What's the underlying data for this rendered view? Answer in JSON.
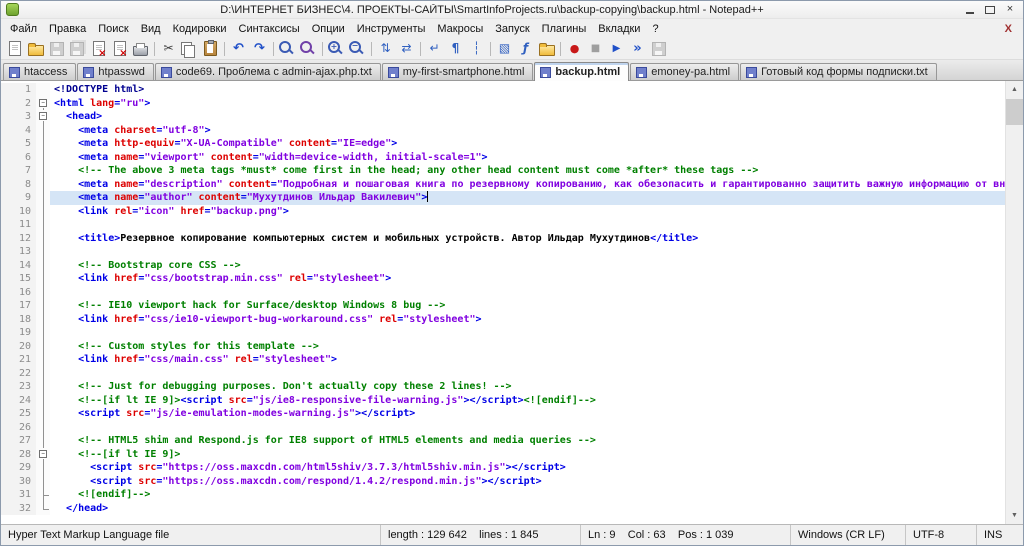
{
  "window": {
    "title": "D:\\ИНТЕРНЕТ БИЗНЕС\\4. ПРОЕКТЫ-САЙТЫ\\SmartInfoProjects.ru\\backup-copying\\backup.html - Notepad++"
  },
  "menubar": {
    "items": [
      {
        "label": "Файл",
        "name": "file"
      },
      {
        "label": "Правка",
        "name": "edit"
      },
      {
        "label": "Поиск",
        "name": "search"
      },
      {
        "label": "Вид",
        "name": "view"
      },
      {
        "label": "Кодировки",
        "name": "encoding"
      },
      {
        "label": "Синтаксисы",
        "name": "language"
      },
      {
        "label": "Опции",
        "name": "settings"
      },
      {
        "label": "Инструменты",
        "name": "tools"
      },
      {
        "label": "Макросы",
        "name": "macro"
      },
      {
        "label": "Запуск",
        "name": "run"
      },
      {
        "label": "Плагины",
        "name": "plugins"
      },
      {
        "label": "Вкладки",
        "name": "window-tabs"
      },
      {
        "label": "?",
        "name": "help"
      }
    ],
    "close_label": "X"
  },
  "toolbar": {
    "icons": [
      {
        "name": "new-file",
        "enabled": true
      },
      {
        "name": "open-folder",
        "enabled": true
      },
      {
        "name": "save",
        "enabled": false
      },
      {
        "name": "save-all",
        "enabled": false
      },
      {
        "name": "close-file",
        "enabled": true
      },
      {
        "name": "close-all",
        "enabled": true
      },
      {
        "name": "print",
        "enabled": true
      },
      {
        "name": "separator"
      },
      {
        "name": "cut",
        "enabled": true
      },
      {
        "name": "copy",
        "enabled": true
      },
      {
        "name": "paste",
        "enabled": true
      },
      {
        "name": "separator"
      },
      {
        "name": "undo",
        "enabled": true
      },
      {
        "name": "redo",
        "enabled": true
      },
      {
        "name": "separator"
      },
      {
        "name": "find",
        "enabled": true
      },
      {
        "name": "replace",
        "enabled": true
      },
      {
        "name": "separator"
      },
      {
        "name": "zoom-in",
        "enabled": true
      },
      {
        "name": "zoom-out",
        "enabled": true
      },
      {
        "name": "separator"
      },
      {
        "name": "sync-vertical",
        "enabled": true
      },
      {
        "name": "sync-horizontal",
        "enabled": true
      },
      {
        "name": "separator"
      },
      {
        "name": "word-wrap",
        "enabled": true
      },
      {
        "name": "show-all-chars",
        "enabled": true
      },
      {
        "name": "indent-guide",
        "enabled": true
      },
      {
        "name": "separator"
      },
      {
        "name": "doc-map",
        "enabled": true
      },
      {
        "name": "function-list",
        "enabled": true
      },
      {
        "name": "folder-workspace",
        "enabled": true
      },
      {
        "name": "separator"
      },
      {
        "name": "record-macro",
        "enabled": true
      },
      {
        "name": "stop-macro",
        "enabled": false
      },
      {
        "name": "play-macro",
        "enabled": true
      },
      {
        "name": "run-macro-multi",
        "enabled": true
      },
      {
        "name": "save-macro",
        "enabled": false
      }
    ]
  },
  "tabs": [
    {
      "label": "htaccess",
      "name": "htaccess",
      "active": false
    },
    {
      "label": "htpasswd",
      "name": "htpasswd",
      "active": false
    },
    {
      "label": "code69. Проблема с admin-ajax.php.txt",
      "name": "code69-admin-ajax",
      "active": false
    },
    {
      "label": "my-first-smartphone.html",
      "name": "my-first-smartphone",
      "active": false
    },
    {
      "label": "backup.html",
      "name": "backup",
      "active": true
    },
    {
      "label": "emoney-pa.html",
      "name": "emoney-pa",
      "active": false
    },
    {
      "label": "Готовый код формы подписки.txt",
      "name": "subscribe-form-code",
      "active": false
    }
  ],
  "editor": {
    "caret": {
      "line": 9,
      "col": 63
    },
    "lines": [
      {
        "n": 1,
        "i": 0,
        "f": "",
        "segs": [
          [
            "d",
            "<!DOCTYPE html>"
          ]
        ]
      },
      {
        "n": 2,
        "i": 0,
        "f": "box",
        "segs": [
          [
            "t",
            "<html "
          ],
          [
            "a",
            "lang"
          ],
          [
            "t",
            "="
          ],
          [
            "v",
            "\"ru\""
          ],
          [
            "t",
            ">"
          ]
        ]
      },
      {
        "n": 3,
        "i": 2,
        "f": "box",
        "segs": [
          [
            "t",
            "<head>"
          ]
        ]
      },
      {
        "n": 4,
        "i": 4,
        "f": "line",
        "segs": [
          [
            "t",
            "<meta "
          ],
          [
            "a",
            "charset"
          ],
          [
            "t",
            "="
          ],
          [
            "v",
            "\"utf-8\""
          ],
          [
            "t",
            ">"
          ]
        ]
      },
      {
        "n": 5,
        "i": 4,
        "f": "line",
        "segs": [
          [
            "t",
            "<meta "
          ],
          [
            "a",
            "http-equiv"
          ],
          [
            "t",
            "="
          ],
          [
            "v",
            "\"X-UA-Compatible\""
          ],
          [
            "a",
            " content"
          ],
          [
            "t",
            "="
          ],
          [
            "v",
            "\"IE=edge\""
          ],
          [
            "t",
            ">"
          ]
        ]
      },
      {
        "n": 6,
        "i": 4,
        "f": "line",
        "segs": [
          [
            "t",
            "<meta "
          ],
          [
            "a",
            "name"
          ],
          [
            "t",
            "="
          ],
          [
            "v",
            "\"viewport\""
          ],
          [
            "a",
            " content"
          ],
          [
            "t",
            "="
          ],
          [
            "v",
            "\"width=device-width, initial-scale=1\""
          ],
          [
            "t",
            ">"
          ]
        ]
      },
      {
        "n": 7,
        "i": 4,
        "f": "line",
        "segs": [
          [
            "c",
            "<!-- The above 3 meta tags *must* come first in the head; any other head content must come *after* these tags -->"
          ]
        ]
      },
      {
        "n": 8,
        "i": 4,
        "f": "line",
        "segs": [
          [
            "t",
            "<meta "
          ],
          [
            "a",
            "name"
          ],
          [
            "t",
            "="
          ],
          [
            "v",
            "\"description\""
          ],
          [
            "a",
            " content"
          ],
          [
            "t",
            "="
          ],
          [
            "v",
            "\"Подробная и пошаговая книга по резервному копированию, как обезопасить и гарантированно защитить важную информацию от внез"
          ]
        ]
      },
      {
        "n": 9,
        "i": 4,
        "f": "line",
        "cur": true,
        "caret": true,
        "segs": [
          [
            "t",
            "<meta "
          ],
          [
            "a",
            "name"
          ],
          [
            "t",
            "="
          ],
          [
            "v",
            "\"author\""
          ],
          [
            "a",
            " content"
          ],
          [
            "t",
            "="
          ],
          [
            "v",
            "\"Мухутдинов Ильдар Вакилевич\""
          ],
          [
            "t",
            ">"
          ]
        ]
      },
      {
        "n": 10,
        "i": 4,
        "f": "line",
        "segs": [
          [
            "t",
            "<link "
          ],
          [
            "a",
            "rel"
          ],
          [
            "t",
            "="
          ],
          [
            "v",
            "\"icon\""
          ],
          [
            "a",
            " href"
          ],
          [
            "t",
            "="
          ],
          [
            "v",
            "\"backup.png\""
          ],
          [
            "t",
            ">"
          ]
        ]
      },
      {
        "n": 11,
        "i": 0,
        "f": "line",
        "segs": []
      },
      {
        "n": 12,
        "i": 4,
        "f": "line",
        "segs": [
          [
            "t",
            "<title>"
          ],
          [
            "x",
            "Резервное копирование компьютерных систем и мобильных устройств. Автор Ильдар Мухутдинов"
          ],
          [
            "t",
            "</title>"
          ]
        ]
      },
      {
        "n": 13,
        "i": 0,
        "f": "line",
        "segs": []
      },
      {
        "n": 14,
        "i": 4,
        "f": "line",
        "segs": [
          [
            "c",
            "<!-- Bootstrap core CSS -->"
          ]
        ]
      },
      {
        "n": 15,
        "i": 4,
        "f": "line",
        "segs": [
          [
            "t",
            "<link "
          ],
          [
            "a",
            "href"
          ],
          [
            "t",
            "="
          ],
          [
            "v",
            "\"css/bootstrap.min.css\""
          ],
          [
            "a",
            " rel"
          ],
          [
            "t",
            "="
          ],
          [
            "v",
            "\"stylesheet\""
          ],
          [
            "t",
            ">"
          ]
        ]
      },
      {
        "n": 16,
        "i": 0,
        "f": "line",
        "segs": []
      },
      {
        "n": 17,
        "i": 4,
        "f": "line",
        "segs": [
          [
            "c",
            "<!-- IE10 viewport hack for Surface/desktop Windows 8 bug -->"
          ]
        ]
      },
      {
        "n": 18,
        "i": 4,
        "f": "line",
        "segs": [
          [
            "t",
            "<link "
          ],
          [
            "a",
            "href"
          ],
          [
            "t",
            "="
          ],
          [
            "v",
            "\"css/ie10-viewport-bug-workaround.css\""
          ],
          [
            "a",
            " rel"
          ],
          [
            "t",
            "="
          ],
          [
            "v",
            "\"stylesheet\""
          ],
          [
            "t",
            ">"
          ]
        ]
      },
      {
        "n": 19,
        "i": 0,
        "f": "line",
        "segs": []
      },
      {
        "n": 20,
        "i": 4,
        "f": "line",
        "segs": [
          [
            "c",
            "<!-- Custom styles for this template -->"
          ]
        ]
      },
      {
        "n": 21,
        "i": 4,
        "f": "line",
        "segs": [
          [
            "t",
            "<link "
          ],
          [
            "a",
            "href"
          ],
          [
            "t",
            "="
          ],
          [
            "v",
            "\"css/main.css\""
          ],
          [
            "a",
            " rel"
          ],
          [
            "t",
            "="
          ],
          [
            "v",
            "\"stylesheet\""
          ],
          [
            "t",
            ">"
          ]
        ]
      },
      {
        "n": 22,
        "i": 0,
        "f": "line",
        "segs": []
      },
      {
        "n": 23,
        "i": 4,
        "f": "line",
        "segs": [
          [
            "c",
            "<!-- Just for debugging purposes. Don't actually copy these 2 lines! -->"
          ]
        ]
      },
      {
        "n": 24,
        "i": 4,
        "f": "line",
        "segs": [
          [
            "c",
            "<!--[if lt IE 9]>"
          ],
          [
            "t",
            "<script "
          ],
          [
            "a",
            "src"
          ],
          [
            "t",
            "="
          ],
          [
            "v",
            "\"js/ie8-responsive-file-warning.js\""
          ],
          [
            "t",
            "></script>"
          ],
          [
            "c",
            "<![endif]-->"
          ]
        ]
      },
      {
        "n": 25,
        "i": 4,
        "f": "line",
        "segs": [
          [
            "t",
            "<script "
          ],
          [
            "a",
            "src"
          ],
          [
            "t",
            "="
          ],
          [
            "v",
            "\"js/ie-emulation-modes-warning.js\""
          ],
          [
            "t",
            "></script>"
          ]
        ]
      },
      {
        "n": 26,
        "i": 0,
        "f": "line",
        "segs": []
      },
      {
        "n": 27,
        "i": 4,
        "f": "line",
        "segs": [
          [
            "c",
            "<!-- HTML5 shim and Respond.js for IE8 support of HTML5 elements and media queries -->"
          ]
        ]
      },
      {
        "n": 28,
        "i": 4,
        "f": "box",
        "segs": [
          [
            "c",
            "<!--[if lt IE 9]>"
          ]
        ]
      },
      {
        "n": 29,
        "i": 6,
        "f": "line",
        "segs": [
          [
            "t",
            "<script "
          ],
          [
            "a",
            "src"
          ],
          [
            "t",
            "="
          ],
          [
            "v",
            "\"https://oss.maxcdn.com/html5shiv/3.7.3/html5shiv.min.js\""
          ],
          [
            "t",
            "></script>"
          ]
        ]
      },
      {
        "n": 30,
        "i": 6,
        "f": "line",
        "segs": [
          [
            "t",
            "<script "
          ],
          [
            "a",
            "src"
          ],
          [
            "t",
            "="
          ],
          [
            "v",
            "\"https://oss.maxcdn.com/respond/1.4.2/respond.min.js\""
          ],
          [
            "t",
            "></script>"
          ]
        ]
      },
      {
        "n": 31,
        "i": 4,
        "f": "tee",
        "segs": [
          [
            "c",
            "<![endif]-->"
          ]
        ]
      },
      {
        "n": 32,
        "i": 2,
        "f": "end",
        "segs": [
          [
            "t",
            "</head>"
          ]
        ]
      }
    ]
  },
  "statusbar": {
    "doc_type": "Hyper Text Markup Language file",
    "doc_stats": "length : 129 642    lines : 1 845",
    "cursor_position": "Ln : 9    Col : 63    Pos : 1 039",
    "eol_format": "Windows (CR LF)",
    "encoding": "UTF-8",
    "insert_mode": "INS"
  },
  "colors": {
    "tag": "#0000E6",
    "attr": "#DD0000",
    "value": "#8000E0",
    "comment": "#008000",
    "text": "#000000",
    "doctype": "#000090",
    "curline": "#D5E5F6"
  }
}
